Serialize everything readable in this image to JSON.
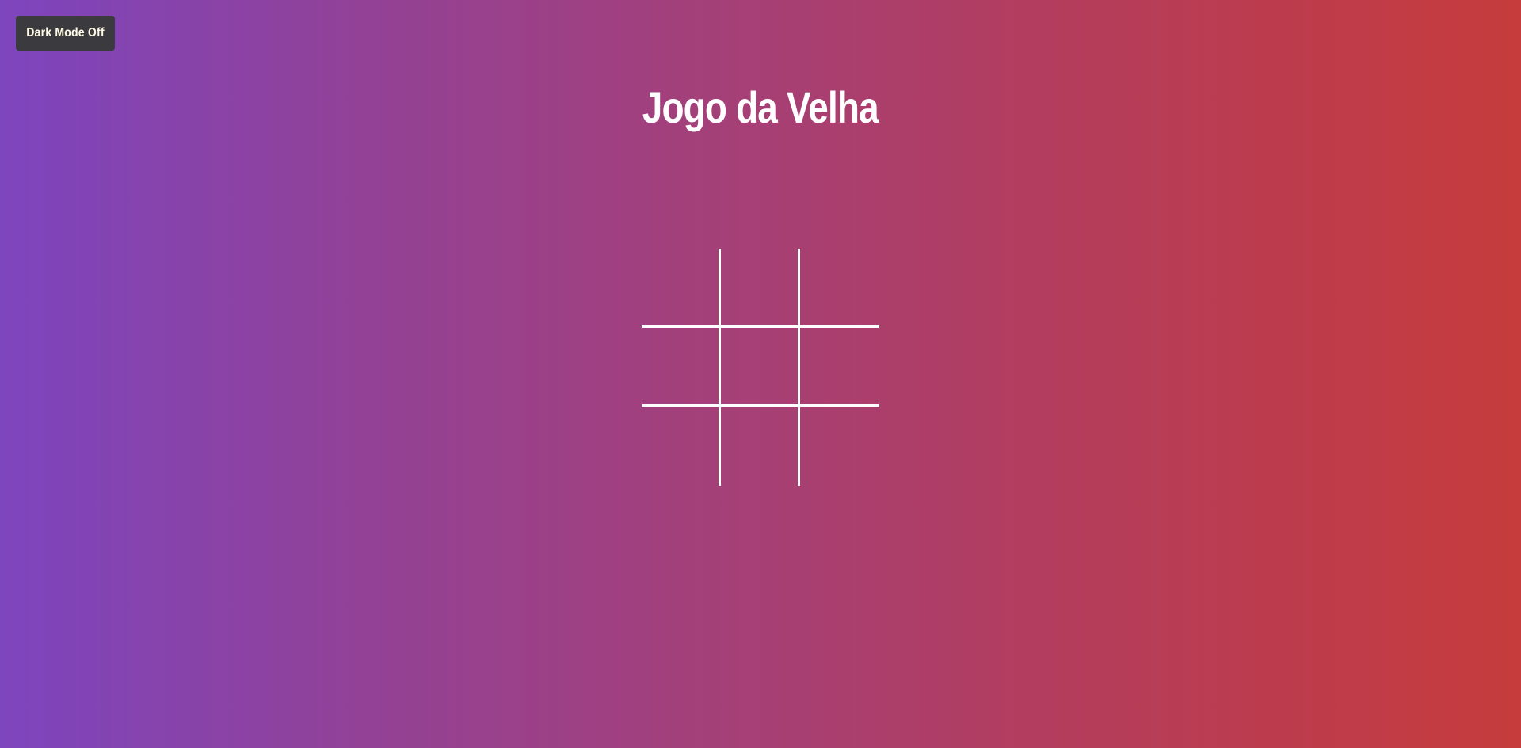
{
  "toolbar": {
    "dark_mode_label": "Dark Mode Off"
  },
  "header": {
    "title": "Jogo da Velha"
  },
  "board": {
    "cells": [
      "",
      "",
      "",
      "",
      "",
      "",
      "",
      "",
      ""
    ]
  },
  "colors": {
    "gradient_start": "#7d45be",
    "gradient_end": "#c63c3c",
    "button_bg": "#3b3b3f",
    "line_color": "#ffffff"
  }
}
